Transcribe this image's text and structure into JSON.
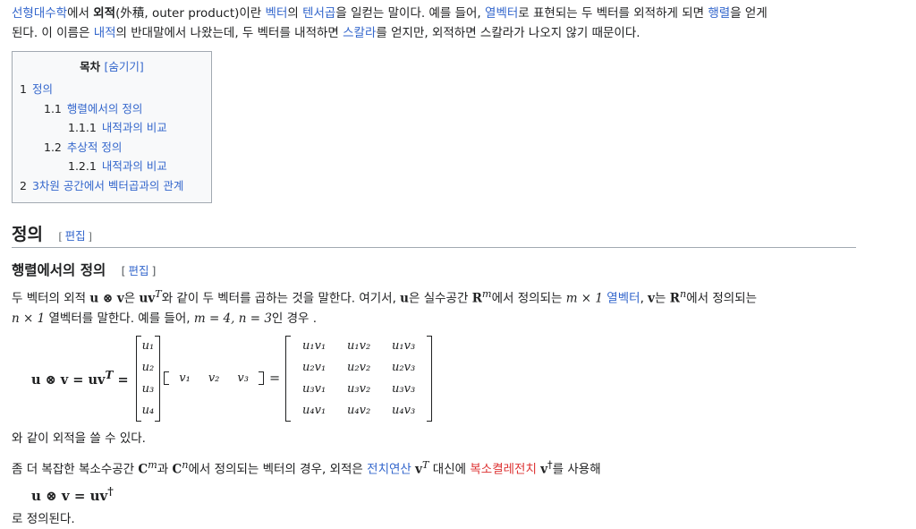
{
  "intro": {
    "s1": "선형대수학",
    "s2": "에서 ",
    "s3": "외적",
    "s4": "(外積, outer product)이란 ",
    "s5": "벡터",
    "s6": "의 ",
    "s7": "텐서곱",
    "s8": "을 일컫는 말이다. 예를 들어, ",
    "s9": "열벡터",
    "s10": "로 표현되는 두 벡터를 외적하게 되면 ",
    "s11": "행렬",
    "s12": "을 얻게",
    "s13": "된다. 이 이름은 ",
    "s14": "내적",
    "s15": "의 반대말에서 나왔는데, 두 벡터를 내적하면 ",
    "s16": "스칼라",
    "s17": "를 얻지만, 외적하면 스칼라가 나오지 않기 때문이다."
  },
  "toc": {
    "title": "목차",
    "toggle": "[숨기기]",
    "items": [
      {
        "num": "1",
        "label": "정의"
      },
      {
        "num": "1.1",
        "label": "행렬에서의 정의"
      },
      {
        "num": "1.1.1",
        "label": "내적과의 비교"
      },
      {
        "num": "1.2",
        "label": "추상적 정의"
      },
      {
        "num": "1.2.1",
        "label": "내적과의 비교"
      },
      {
        "num": "2",
        "label": "3차원 공간에서 벡터곱과의 관계"
      }
    ]
  },
  "section1": {
    "title": "정의",
    "edit_open": "[",
    "edit_label": "편집",
    "edit_close": "]"
  },
  "section11": {
    "title": "행렬에서의 정의",
    "edit_open": "[",
    "edit_label": "편집",
    "edit_close": "]"
  },
  "para1": {
    "t1": "두 벡터의 외적 ",
    "m1": "u ⊗ v",
    "t2": "은 ",
    "m2": "uv",
    "m2sup": "T",
    "t3": "와 같이 두 벡터를 곱하는 것을 말한다. 여기서, ",
    "m3": "u",
    "t4": "은 실수공간 ",
    "m4": "R",
    "m4sup": "m",
    "t5": "에서 정의되는 ",
    "m5": "m × 1",
    "t6": " ",
    "l1": "열벡터",
    "t7": ", ",
    "m6": "v",
    "t8": "는 ",
    "m7": "R",
    "m7sup": "n",
    "t9": "에서 정의되는",
    "m8": "n × 1",
    "t10": " 열벡터를 말한다. 예를 들어, ",
    "m9": "m = 4, n = 3",
    "t11": "인 경우 ."
  },
  "equation1": {
    "lhs_a": "u ⊗ v = uv",
    "lhs_sup": "T",
    "lhs_eq": "=",
    "u_col": [
      "u₁",
      "u₂",
      "u₃",
      "u₄"
    ],
    "v_row": [
      "v₁",
      "v₂",
      "v₃"
    ],
    "mid_eq": "=",
    "matrix": [
      "u₁v₁",
      "u₁v₂",
      "u₁v₃",
      "u₂v₁",
      "u₂v₂",
      "u₂v₃",
      "u₃v₁",
      "u₃v₂",
      "u₃v₃",
      "u₄v₁",
      "u₄v₂",
      "u₄v₃"
    ]
  },
  "para2": {
    "text": "와 같이 외적을 쓸 수 있다."
  },
  "para3": {
    "t1": "좀 더 복잡한 복소수공간 ",
    "m1": "C",
    "m1sup": "m",
    "t2": "과 ",
    "m2": "C",
    "m2sup": "n",
    "t3": "에서 정의되는 벡터의 경우, 외적은 ",
    "l1": "전치연산",
    "t4": " ",
    "m3": "v",
    "m3sup": "T",
    "t5": " 대신에 ",
    "r1": "복소켤레전치",
    "t6": " ",
    "m4": "v",
    "m4sup": "†",
    "t7": "를 사용해"
  },
  "equation2": {
    "text": "u ⊗ v = uv",
    "sup": "†"
  },
  "para4": {
    "text": "로 정의된다."
  }
}
